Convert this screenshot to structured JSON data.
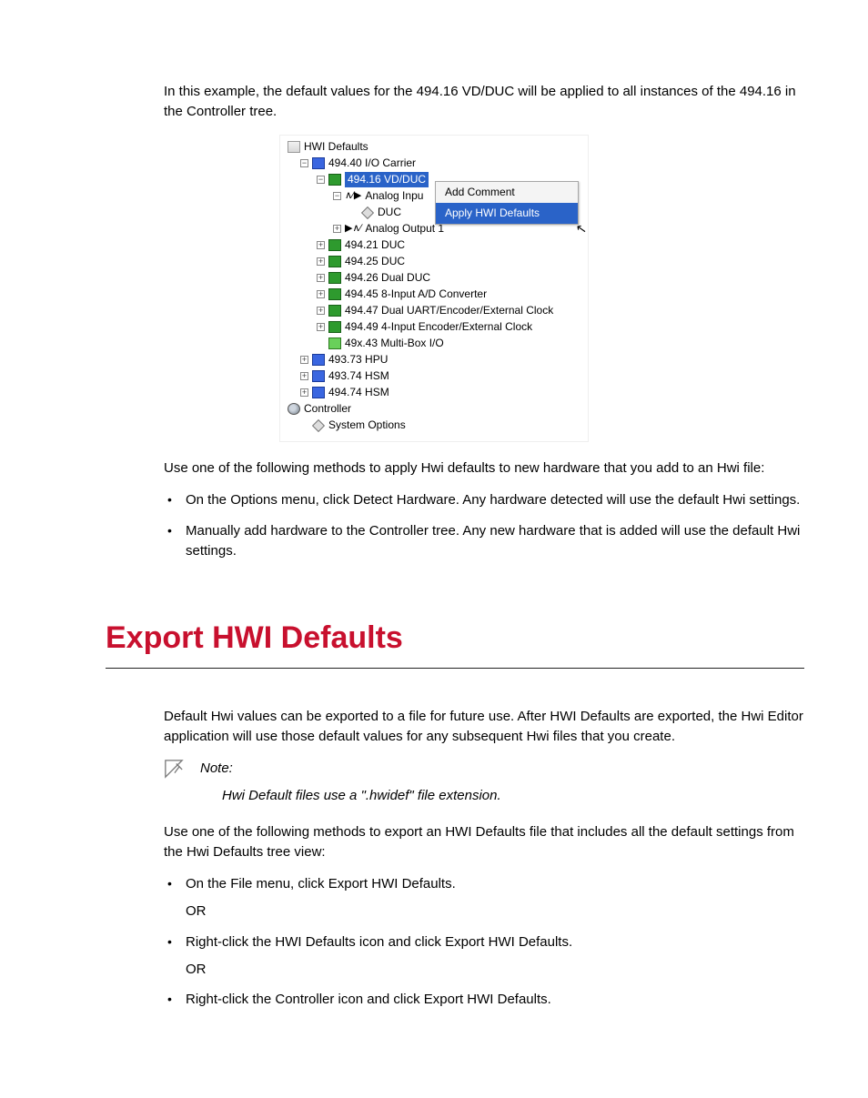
{
  "intro_para": "In this example, the default values for the 494.16 VD/DUC will be applied to all instances of the 494.16 in the Controller tree.",
  "tree": {
    "root": "HWI Defaults",
    "carrier": "494.40 I/O Carrier",
    "selected": "494.16 VD/DUC",
    "analog_input": "Analog Inpu",
    "duc": "DUC",
    "analog_output": "Analog Output 1",
    "items": [
      "494.21 DUC",
      "494.25 DUC",
      "494.26 Dual DUC",
      "494.45 8-Input A/D Converter",
      "494.47 Dual UART/Encoder/External Clock",
      "494.49 4-Input Encoder/External Clock"
    ],
    "multibox": "49x.43 Multi-Box I/O",
    "hpu": "493.73 HPU",
    "hsm1": "493.74 HSM",
    "hsm2": "494.74 HSM",
    "controller": "Controller",
    "system_options": "System Options"
  },
  "context_menu": {
    "item1": "Add Comment",
    "item2": "Apply HWI Defaults"
  },
  "para2": "Use one of the following methods to apply Hwi defaults to new hardware that you add to an Hwi file:",
  "apply_bullets": [
    "On the Options menu, click Detect Hardware. Any hardware detected will use the default Hwi settings.",
    "Manually add hardware to the Controller tree. Any new hardware that is added will use the default Hwi settings."
  ],
  "section_heading": "Export HWI Defaults",
  "export_para1": "Default Hwi values can be exported to a file for future use. After HWI Defaults are exported, the Hwi Editor application will use those default values for any subsequent Hwi files that you create.",
  "note_label": "Note:",
  "note_body": "Hwi Default files use a \".hwidef\" file extension.",
  "export_para2": "Use one of the following methods to export an HWI Defaults file that includes all the default settings from the Hwi Defaults tree view:",
  "export_bullets": [
    {
      "text": "On the File menu, click Export HWI Defaults.",
      "or": "OR"
    },
    {
      "text": "Right-click the HWI Defaults icon and click Export HWI Defaults.",
      "or": "OR"
    },
    {
      "text": "Right-click the Controller icon and click Export HWI Defaults.",
      "or": ""
    }
  ]
}
